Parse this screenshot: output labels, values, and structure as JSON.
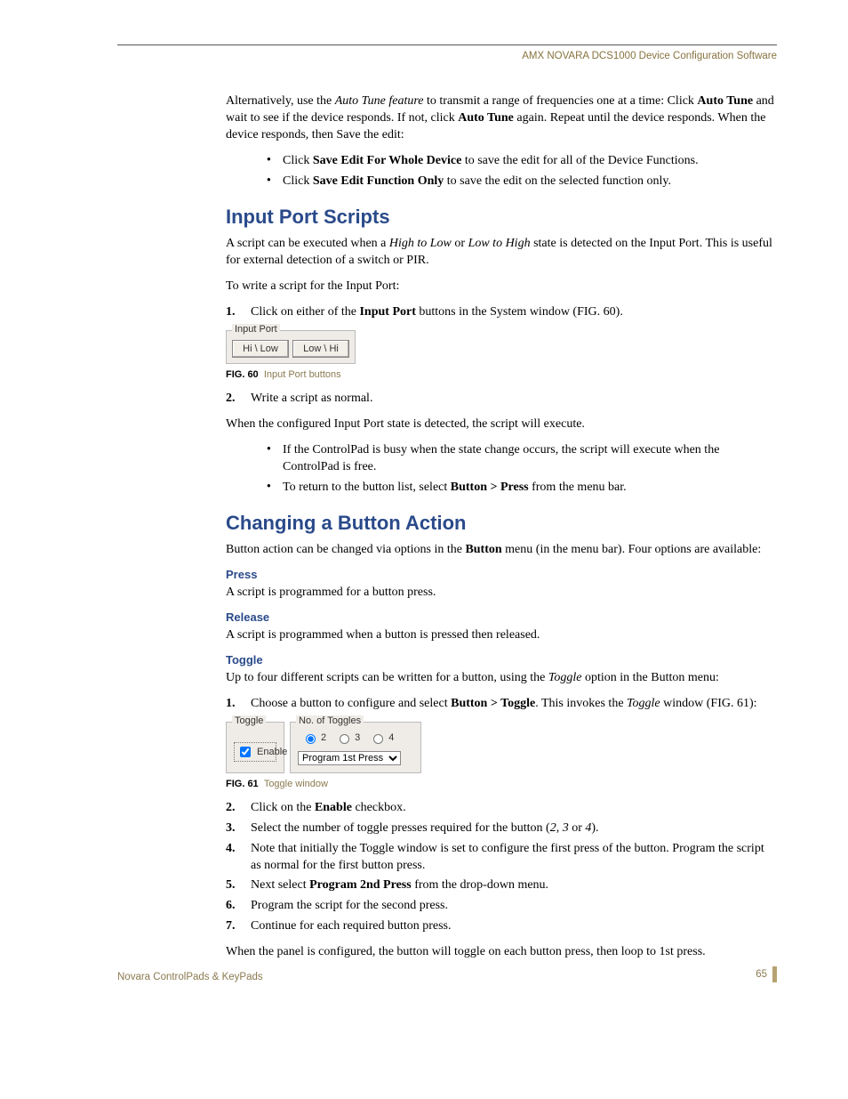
{
  "header": {
    "title": "AMX NOVARA DCS1000 Device Configuration Software"
  },
  "intro": {
    "p1a": "Alternatively, use the ",
    "p1b_ital": "Auto Tune feature",
    "p1c": " to transmit a range of frequencies one at a time: Click ",
    "p1d_bold": "Auto Tune",
    "p1e": " and wait to see if the device responds. If not, click ",
    "p1f_bold": "Auto Tune",
    "p1g": " again. Repeat until the device responds. When the device responds, then Save the edit:",
    "b1a": "Click ",
    "b1b_bold": "Save Edit For Whole Device",
    "b1c": " to save the edit for all of the Device Functions.",
    "b2a": "Click ",
    "b2b_bold": "Save Edit Function Only",
    "b2c": " to save the edit on the selected function only."
  },
  "sec1": {
    "title": "Input Port Scripts",
    "p1a": "A script can be executed when a ",
    "p1b_ital": "High to Low",
    "p1c": " or ",
    "p1d_ital": "Low to High",
    "p1e": " state is detected on the Input Port. This is useful for external detection of a switch or PIR.",
    "p2": "To write a script for the Input Port:",
    "s1num": "1.",
    "s1a": "Click on either of the ",
    "s1b_bold": "Input Port",
    "s1c": " buttons in the System window (FIG. 60).",
    "widget": {
      "legend": "Input Port",
      "btn1": "Hi \\ Low",
      "btn2": "Low \\ Hi"
    },
    "figlabel": "FIG. 60",
    "figtext": "Input Port buttons",
    "s2num": "2.",
    "s2": "Write a script as normal.",
    "p3": "When the configured Input Port state is detected, the script will execute.",
    "b1": "If the ControlPad is busy when the state change occurs, the script will execute when the ControlPad is free.",
    "b2a": "To return to the button list, select ",
    "b2b_bold": "Button > Press",
    "b2c": " from the menu bar."
  },
  "sec2": {
    "title": "Changing a Button Action",
    "p1a": "Button action can be changed via options in the ",
    "p1b_bold": "Button",
    "p1c": " menu (in the menu bar). Four options are available:",
    "press_h": "Press",
    "press_p": "A script is programmed for a button press.",
    "release_h": "Release",
    "release_p": "A script is programmed when a button is pressed then released.",
    "toggle_h": "Toggle",
    "toggle_p1a": "Up to four different scripts can be written for a button, using the ",
    "toggle_p1b_ital": "Toggle",
    "toggle_p1c": " option in the Button menu:",
    "t1num": "1.",
    "t1a": "Choose a button to configure and select ",
    "t1b_bold": "Button > Toggle",
    "t1c": ". This invokes the ",
    "t1d_ital": "Toggle",
    "t1e": " window (FIG. 61):",
    "widget": {
      "left_legend": "Toggle",
      "enable": "Enable",
      "right_legend": "No. of Toggles",
      "r2": "2",
      "r3": "3",
      "r4": "4",
      "select": "Program 1st Press"
    },
    "figlabel": "FIG. 61",
    "figtext": "Toggle window",
    "t2num": "2.",
    "t2a": "Click on the ",
    "t2b_bold": "Enable",
    "t2c": " checkbox.",
    "t3num": "3.",
    "t3a": "Select the number of toggle presses required for the button (",
    "t3b_ital": "2",
    "t3c": ", ",
    "t3d_ital": "3",
    "t3e": " or ",
    "t3f_ital": "4",
    "t3g": ").",
    "t4num": "4.",
    "t4": "Note that initially the Toggle window is set to configure the first press of the button. Program the script as normal for the first button press.",
    "t5num": "5.",
    "t5a": "Next select ",
    "t5b_bold": "Program 2nd Press",
    "t5c": " from the drop-down menu.",
    "t6num": "6.",
    "t6": "Program the script for the second press.",
    "t7num": "7.",
    "t7": "Continue for each required button press.",
    "p2": "When the panel is configured, the button will toggle on each button press, then loop to 1st press."
  },
  "footer": {
    "title": "Novara ControlPads & KeyPads",
    "page": "65"
  }
}
